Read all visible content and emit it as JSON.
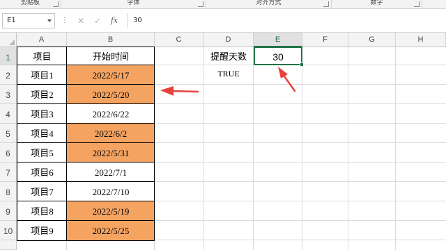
{
  "ribbon": {
    "groups": [
      "剪贴板",
      "字体",
      "对齐方式",
      "数字"
    ]
  },
  "formula_bar": {
    "name_box": "E1",
    "cancel_icon": "✕",
    "enter_icon": "✓",
    "fx_label": "fx",
    "formula": "30"
  },
  "columns": [
    "A",
    "B",
    "C",
    "D",
    "E",
    "F",
    "G",
    "H"
  ],
  "rows": [
    "1",
    "2",
    "3",
    "4",
    "5",
    "6",
    "7",
    "8",
    "9",
    "10"
  ],
  "selected_cell": "E1",
  "table": {
    "header": [
      "项目",
      "开始时间"
    ],
    "rows": [
      {
        "item": "项目1",
        "date": "2022/5/17",
        "highlighted": true
      },
      {
        "item": "项目2",
        "date": "2022/5/20",
        "highlighted": true
      },
      {
        "item": "项目3",
        "date": "2022/6/22",
        "highlighted": false
      },
      {
        "item": "项目4",
        "date": "2022/6/2",
        "highlighted": true
      },
      {
        "item": "项目5",
        "date": "2022/5/31",
        "highlighted": true
      },
      {
        "item": "项目6",
        "date": "2022/7/1",
        "highlighted": false
      },
      {
        "item": "项目7",
        "date": "2022/7/10",
        "highlighted": false
      },
      {
        "item": "项目8",
        "date": "2022/5/19",
        "highlighted": true
      },
      {
        "item": "项目9",
        "date": "2022/5/25",
        "highlighted": true
      }
    ]
  },
  "reminder": {
    "label": "提醒天数",
    "days": "30",
    "flag": "TRUE"
  },
  "colors": {
    "highlight": "#f4a361",
    "annotation_arrow": "#e8413c",
    "selection": "#217346"
  }
}
